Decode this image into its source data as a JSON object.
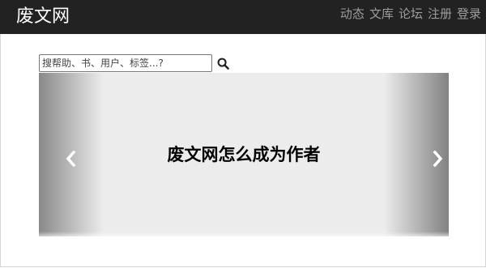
{
  "navbar": {
    "brand": "废文网",
    "links": [
      {
        "label": "动态"
      },
      {
        "label": "文库"
      },
      {
        "label": "论坛"
      },
      {
        "label": "注册"
      },
      {
        "label": "登录"
      }
    ]
  },
  "search": {
    "placeholder": "搜帮助、书、用户、标签...?",
    "button_icon": "search-icon"
  },
  "carousel": {
    "slide_title": "废文网怎么成为作者",
    "prev_icon": "chevron-left-icon",
    "next_icon": "chevron-right-icon"
  },
  "colors": {
    "navbar_bg": "#222222",
    "brand_text": "#ffffff",
    "nav_link_text": "#9d9d9d",
    "carousel_bg": "#ececec"
  }
}
